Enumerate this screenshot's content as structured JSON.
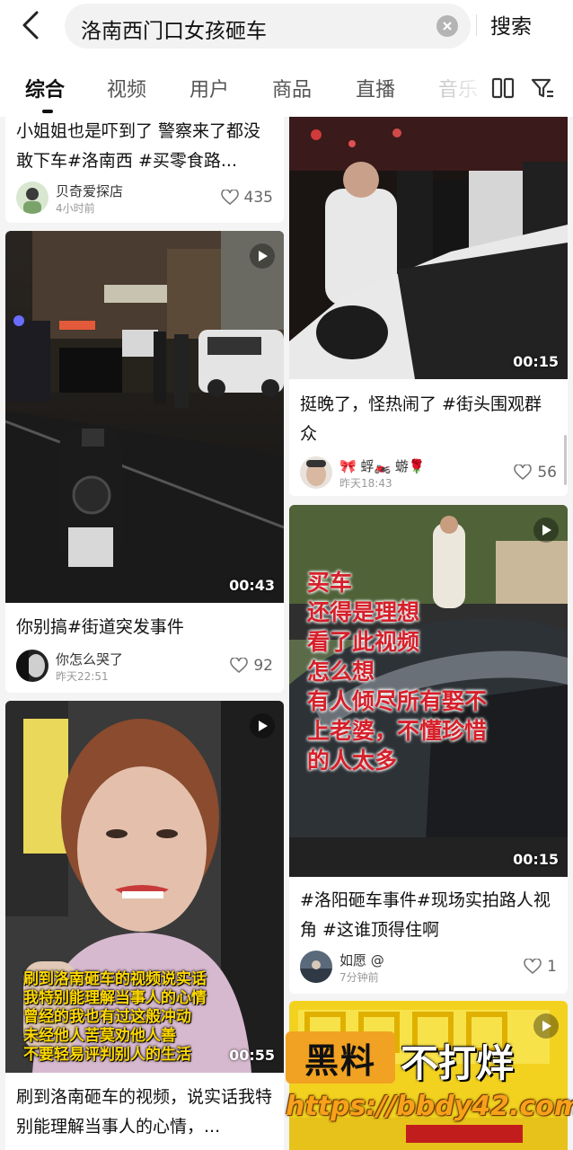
{
  "search": {
    "query": "洛南西门口女孩砸车",
    "button_label": "搜索"
  },
  "tabs": [
    {
      "label": "综合",
      "active": true
    },
    {
      "label": "视频"
    },
    {
      "label": "用户"
    },
    {
      "label": "商品"
    },
    {
      "label": "直播"
    },
    {
      "label": "音乐"
    }
  ],
  "feed": {
    "left": [
      {
        "title": "小姐姐也是吓到了 警察来了都没敢下车#洛南西 #买零食路...",
        "author": "贝奇爱探店",
        "time": "4小时前",
        "likes": "435"
      },
      {
        "duration": "00:43",
        "title": "你别搞#街道突发事件",
        "author": "你怎么哭了",
        "time": "昨天22:51",
        "likes": "92"
      },
      {
        "duration": "00:55",
        "overlay_lines": [
          "刷到洛南砸车的视频说实话",
          "我特别能理解当事人的心情",
          "曾经的我也有过这般冲动",
          "未经他人苦莫劝他人善",
          "不要轻易评判别人的生活"
        ],
        "title": "刷到洛南砸车的视频，说实话我特别能理解当事人的心情，..."
      }
    ],
    "right": [
      {
        "duration": "00:15",
        "title": "挺晚了，怪热闹了 #街头围观群众",
        "author": "🎀 蜉🏍️ 蝣🌹",
        "time": "昨天18:43",
        "likes": "56"
      },
      {
        "duration": "00:15",
        "overlay_lines": [
          "买车",
          "还得是理想",
          "看了此视频",
          "怎么想",
          "有人倾尽所有娶不",
          "上老婆，不懂珍惜",
          "的人太多"
        ],
        "title": "#洛阳砸车事件#现场实拍路人视角 #这谁顶得住啊",
        "author": "如愿 @",
        "time": "7分钟前",
        "likes": "1"
      }
    ]
  },
  "watermark": {
    "badge": "黑料",
    "text": "不打烊",
    "url": "https://bbdy42.com"
  },
  "colors": {
    "accent_red": "#d6202a",
    "overlay_yellow": "#ffd900",
    "watermark_orange": "#f1a222"
  }
}
